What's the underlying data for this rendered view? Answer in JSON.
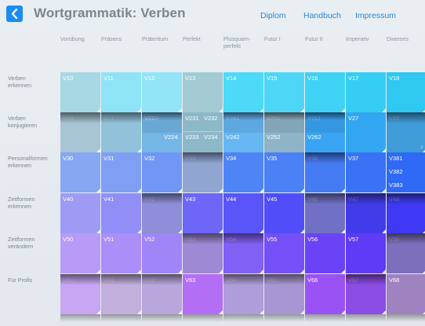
{
  "header": {
    "title": "Wortgrammatik: Verben",
    "nav": [
      "Diplom",
      "Handbuch",
      "Impressum"
    ]
  },
  "columns": [
    "Vorübung",
    "Präsens",
    "Präteritum",
    "Perfekt",
    "Plusquam-\nperfekt",
    "Futur I",
    "Futur II",
    "Imperativ",
    "Diverses"
  ],
  "rows": [
    {
      "label": "Verben\nerkennen"
    },
    {
      "label": "Verben\nkonjugieren"
    },
    {
      "label": "Personalformen\nerkennen"
    },
    {
      "label": "Zeitformen\nerkennen"
    },
    {
      "label": "Zeitformen\nverändern"
    },
    {
      "label": "Für Profis"
    }
  ],
  "cells": [
    [
      {
        "label": "V10",
        "color": "#a8d8e4",
        "state": "active"
      },
      {
        "label": "V11",
        "color": "#8fe3f7",
        "state": "active"
      },
      {
        "label": "V12",
        "color": "#92e5f6",
        "state": "active"
      },
      {
        "label": "V13",
        "color": "#a4cbd3",
        "state": "active"
      },
      {
        "label": "V14",
        "color": "#4dd9f8",
        "state": "active"
      },
      {
        "label": "V15",
        "color": "#4ed6f7",
        "state": "active"
      },
      {
        "label": "V16",
        "color": "#3fd2f5",
        "state": "active"
      },
      {
        "label": "V17",
        "color": "#35cdf3",
        "state": "active"
      },
      {
        "label": "V18",
        "color": "#2ec8f1",
        "state": "active"
      }
    ],
    [
      {
        "label": "V20",
        "color": "#a5c4d4",
        "state": "dim"
      },
      {
        "label": "V21",
        "color": "#8fc1da",
        "state": "dim"
      },
      {
        "label": "V22",
        "color": "#74b6e6",
        "state": "split",
        "sub": [
          "V223",
          "V224"
        ]
      },
      {
        "label": "V231",
        "color": "#8cb8c8",
        "state": "quad",
        "sub": [
          "V231",
          "V232",
          "V233",
          "V234"
        ]
      },
      {
        "label": "V241",
        "color": "#66b6f4",
        "state": "split",
        "sub": [
          "V242"
        ]
      },
      {
        "label": "V251",
        "color": "#8fb4c8",
        "state": "split",
        "sub": [
          "V252"
        ]
      },
      {
        "label": "V261",
        "color": "#3aa4f4",
        "state": "split",
        "sub": [
          "V262"
        ]
      },
      {
        "label": "V27",
        "color": "#33a6f2",
        "state": "active"
      },
      {
        "label": "V28",
        "color": "#3a9ad8",
        "state": "dim"
      }
    ],
    [
      {
        "label": "V30",
        "color": "#86a8f3",
        "state": "active"
      },
      {
        "label": "V31",
        "color": "#7f9ff4",
        "state": "active"
      },
      {
        "label": "V32",
        "color": "#7296f6",
        "state": "active"
      },
      {
        "label": "V33",
        "color": "#8fa3d2",
        "state": "dim"
      },
      {
        "label": "V34",
        "color": "#4f84f7",
        "state": "active"
      },
      {
        "label": "V35",
        "color": "#4c80f7",
        "state": "active"
      },
      {
        "label": "V36",
        "color": "#3f78f4",
        "state": "dim"
      },
      {
        "label": "V37",
        "color": "#3a72f6",
        "state": "active"
      },
      {
        "label": "V381",
        "color": "#2f6af7",
        "state": "list",
        "sub": [
          "V381",
          "V382",
          "V383"
        ]
      }
    ],
    [
      {
        "label": "V40",
        "color": "#9e9bf5",
        "state": "active"
      },
      {
        "label": "V41",
        "color": "#918ef7",
        "state": "active"
      },
      {
        "label": "V42",
        "color": "#8d8cd8",
        "state": "dim"
      },
      {
        "label": "V43",
        "color": "#6d66f7",
        "state": "active"
      },
      {
        "label": "V44",
        "color": "#5a55f8",
        "state": "active"
      },
      {
        "label": "V45",
        "color": "#514df8",
        "state": "active"
      },
      {
        "label": "V46",
        "color": "#6d6dc4",
        "state": "dim"
      },
      {
        "label": "V47",
        "color": "#3d36ea",
        "state": "dim"
      },
      {
        "label": "V48",
        "color": "#3a34f4",
        "state": "dim"
      }
    ],
    [
      {
        "label": "V50",
        "color": "#b89bf7",
        "state": "active"
      },
      {
        "label": "V51",
        "color": "#ab8ef8",
        "state": "active"
      },
      {
        "label": "V52",
        "color": "#9f85f8",
        "state": "active"
      },
      {
        "label": "V53",
        "color": "#9b86d4",
        "state": "dim"
      },
      {
        "label": "V54",
        "color": "#7d5cf6",
        "state": "dim"
      },
      {
        "label": "V55",
        "color": "#7550f8",
        "state": "active"
      },
      {
        "label": "V56",
        "color": "#6a43f6",
        "state": "active"
      },
      {
        "label": "V57",
        "color": "#5f3bf6",
        "state": "active"
      },
      {
        "label": "V58",
        "color": "#7a6cba",
        "state": "dim"
      }
    ],
    [
      {
        "label": "V60",
        "color": "#c8a4f5",
        "state": "dim"
      },
      {
        "label": "V61",
        "color": "#c2aedc",
        "state": "dim"
      },
      {
        "label": "V62",
        "color": "#b8a4dc",
        "state": "dim"
      },
      {
        "label": "V63",
        "color": "#b36ef5",
        "state": "active"
      },
      {
        "label": "V64",
        "color": "#ad9bd8",
        "state": "dim"
      },
      {
        "label": "V65",
        "color": "#a794d4",
        "state": "dim"
      },
      {
        "label": "V66",
        "color": "#9b52f4",
        "state": "active"
      },
      {
        "label": "V67",
        "color": "#8a47e6",
        "state": "dim"
      },
      {
        "label": "V68",
        "color": "#9f82c0",
        "state": "active"
      }
    ]
  ],
  "icons": {
    "back": "chevron-left-icon",
    "scroll": "drag-handle-icon"
  }
}
